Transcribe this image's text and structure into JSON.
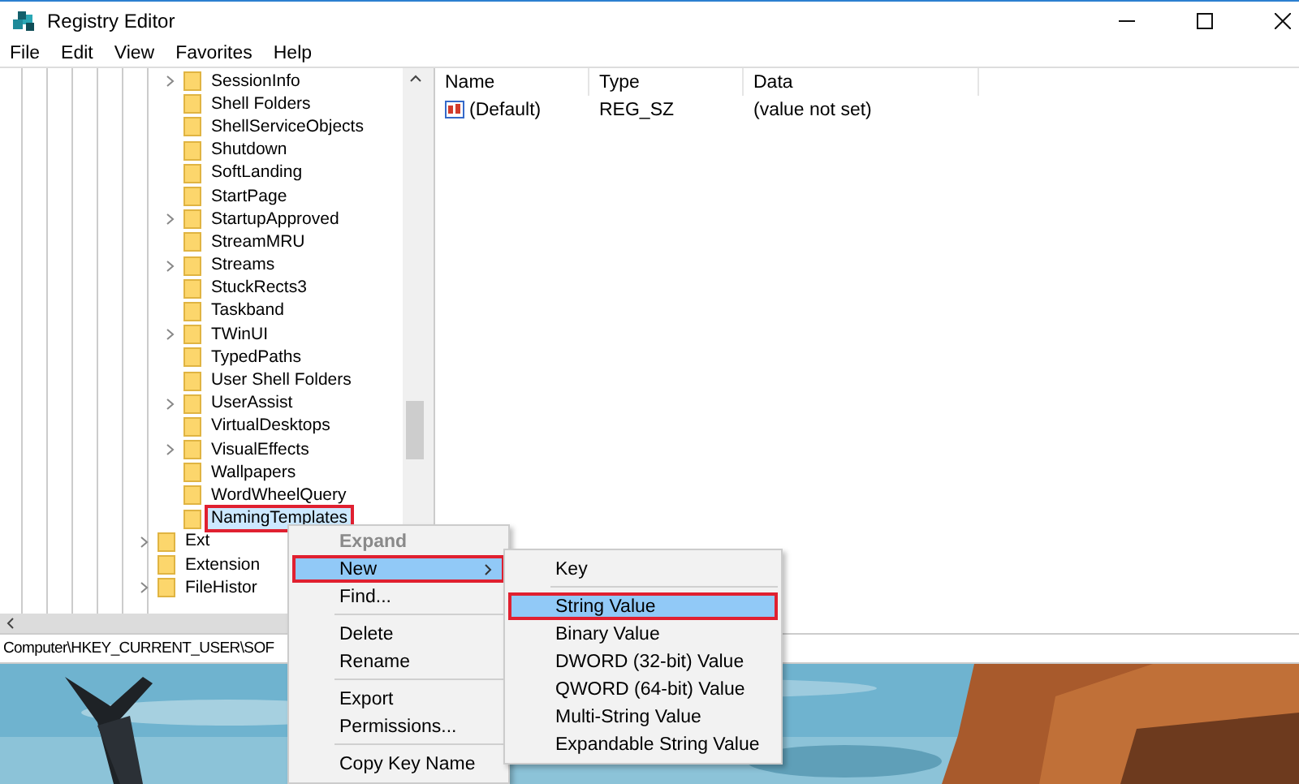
{
  "window": {
    "title": "Registry Editor"
  },
  "menu_bar": [
    "File",
    "Edit",
    "View",
    "Favorites",
    "Help"
  ],
  "tree": {
    "items": [
      {
        "children": [
          {
            "label": "SessionInfo",
            "expandable": true,
            "selected": false
          },
          {
            "label": "Shell Folders",
            "expandable": false,
            "selected": false
          },
          {
            "label": "ShellServiceObjects",
            "expandable": false,
            "selected": false
          },
          {
            "label": "Shutdown",
            "expandable": false,
            "selected": false
          },
          {
            "label": "SoftLanding",
            "expandable": false,
            "selected": false
          },
          {
            "label": "StartPage",
            "expandable": false,
            "selected": false
          },
          {
            "label": "StartupApproved",
            "expandable": true,
            "selected": false
          },
          {
            "label": "StreamMRU",
            "expandable": false,
            "selected": false
          },
          {
            "label": "Streams",
            "expandable": true,
            "selected": false
          },
          {
            "label": "StuckRects3",
            "expandable": false,
            "selected": false
          },
          {
            "label": "Taskband",
            "expandable": false,
            "selected": false
          },
          {
            "label": "TWinUI",
            "expandable": true,
            "selected": false
          },
          {
            "label": "TypedPaths",
            "expandable": false,
            "selected": false
          },
          {
            "label": "User Shell Folders",
            "expandable": false,
            "selected": false
          },
          {
            "label": "UserAssist",
            "expandable": true,
            "selected": false
          },
          {
            "label": "VirtualDesktops",
            "expandable": false,
            "selected": false
          },
          {
            "label": "VisualEffects",
            "expandable": true,
            "selected": false
          },
          {
            "label": "Wallpapers",
            "expandable": false,
            "selected": false
          },
          {
            "label": "WordWheelQuery",
            "expandable": false,
            "selected": false
          },
          {
            "label": "NamingTemplates",
            "expandable": false,
            "selected": true
          }
        ]
      },
      {
        "label": "Ext",
        "expandable": true,
        "selected": false
      },
      {
        "label": "Extension",
        "expandable": false,
        "selected": false
      },
      {
        "label": "FileHistor",
        "expandable": true,
        "selected": false
      }
    ]
  },
  "values_table": {
    "columns": [
      "Name",
      "Type",
      "Data"
    ],
    "rows": [
      {
        "name": "(Default)",
        "type": "REG_SZ",
        "data": "(value not set)"
      }
    ]
  },
  "status_bar": "Computer\\HKEY_CURRENT_USER\\SOF",
  "context_menu": {
    "items": [
      {
        "kind": "item",
        "label": "Expand",
        "disabled": true,
        "default": true,
        "selected": false,
        "submenu": false
      },
      {
        "kind": "item",
        "label": "New",
        "disabled": false,
        "default": false,
        "selected": true,
        "submenu": true
      },
      {
        "kind": "item",
        "label": "Find...",
        "disabled": false,
        "default": false,
        "selected": false,
        "submenu": false
      },
      {
        "kind": "separator"
      },
      {
        "kind": "item",
        "label": "Delete",
        "disabled": false,
        "default": false,
        "selected": false,
        "submenu": false
      },
      {
        "kind": "item",
        "label": "Rename",
        "disabled": false,
        "default": false,
        "selected": false,
        "submenu": false
      },
      {
        "kind": "separator"
      },
      {
        "kind": "item",
        "label": "Export",
        "disabled": false,
        "default": false,
        "selected": false,
        "submenu": false
      },
      {
        "kind": "item",
        "label": "Permissions...",
        "disabled": false,
        "default": false,
        "selected": false,
        "submenu": false
      },
      {
        "kind": "separator"
      },
      {
        "kind": "item",
        "label": "Copy Key Name",
        "disabled": false,
        "default": false,
        "selected": false,
        "submenu": false
      }
    ]
  },
  "submenu": {
    "items": [
      {
        "kind": "item",
        "label": "Key",
        "disabled": false,
        "default": false,
        "selected": false,
        "submenu": false
      },
      {
        "kind": "separator"
      },
      {
        "kind": "item",
        "label": "String Value",
        "disabled": false,
        "default": false,
        "selected": true,
        "submenu": false
      },
      {
        "kind": "item",
        "label": "Binary Value",
        "disabled": false,
        "default": false,
        "selected": false,
        "submenu": false
      },
      {
        "kind": "item",
        "label": "DWORD (32-bit) Value",
        "disabled": false,
        "default": false,
        "selected": false,
        "submenu": false
      },
      {
        "kind": "item",
        "label": "QWORD (64-bit) Value",
        "disabled": false,
        "default": false,
        "selected": false,
        "submenu": false
      },
      {
        "kind": "item",
        "label": "Multi-String Value",
        "disabled": false,
        "default": false,
        "selected": false,
        "submenu": false
      },
      {
        "kind": "item",
        "label": "Expandable String Value",
        "disabled": false,
        "default": false,
        "selected": false,
        "submenu": false
      }
    ]
  }
}
